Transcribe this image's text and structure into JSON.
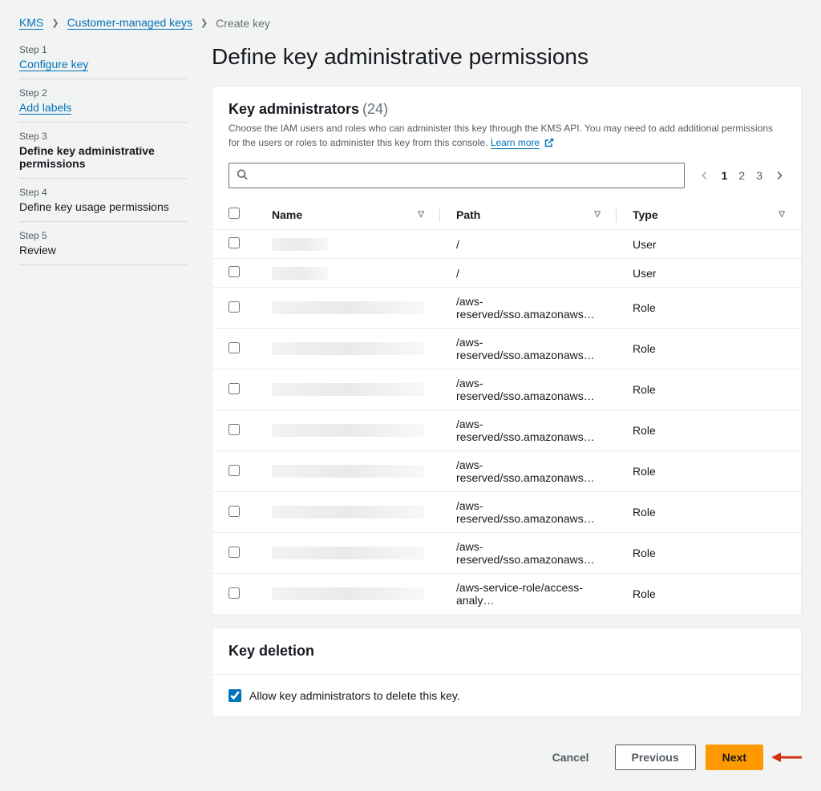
{
  "breadcrumb": {
    "items": [
      "KMS",
      "Customer-managed keys",
      "Create key"
    ]
  },
  "sidebar": {
    "steps": [
      {
        "label": "Step 1",
        "title": "Configure key",
        "link": true,
        "active": false
      },
      {
        "label": "Step 2",
        "title": "Add labels",
        "link": true,
        "active": false
      },
      {
        "label": "Step 3",
        "title": "Define key administrative permissions",
        "link": false,
        "active": true
      },
      {
        "label": "Step 4",
        "title": "Define key usage permissions",
        "link": false,
        "active": false
      },
      {
        "label": "Step 5",
        "title": "Review",
        "link": false,
        "active": false
      }
    ]
  },
  "heading": "Define key administrative permissions",
  "admins_panel": {
    "title": "Key administrators",
    "count": "(24)",
    "description": "Choose the IAM users and roles who can administer this key through the KMS API. You may need to add additional permissions for the users or roles to administer this key from this console.",
    "learn_more": "Learn more",
    "columns": {
      "name": "Name",
      "path": "Path",
      "type": "Type"
    },
    "pagination": {
      "pages": [
        "1",
        "2",
        "3"
      ],
      "current": 0
    },
    "rows": [
      {
        "name_redacted": "small",
        "path": "/",
        "type": "User"
      },
      {
        "name_redacted": "small",
        "path": "/",
        "type": "User"
      },
      {
        "name_redacted": "med",
        "path": "/aws-reserved/sso.amazonaws…",
        "type": "Role"
      },
      {
        "name_redacted": "med",
        "path": "/aws-reserved/sso.amazonaws…",
        "type": "Role"
      },
      {
        "name_redacted": "med",
        "path": "/aws-reserved/sso.amazonaws…",
        "type": "Role"
      },
      {
        "name_redacted": "med",
        "path": "/aws-reserved/sso.amazonaws…",
        "type": "Role"
      },
      {
        "name_redacted": "med",
        "path": "/aws-reserved/sso.amazonaws…",
        "type": "Role"
      },
      {
        "name_redacted": "med",
        "path": "/aws-reserved/sso.amazonaws…",
        "type": "Role"
      },
      {
        "name_redacted": "med",
        "path": "/aws-reserved/sso.amazonaws…",
        "type": "Role"
      },
      {
        "name_redacted": "med",
        "path": "/aws-service-role/access-analy…",
        "type": "Role"
      }
    ]
  },
  "deletion_panel": {
    "title": "Key deletion",
    "checkbox_label": "Allow key administrators to delete this key.",
    "checked": true
  },
  "footer": {
    "cancel": "Cancel",
    "previous": "Previous",
    "next": "Next"
  }
}
